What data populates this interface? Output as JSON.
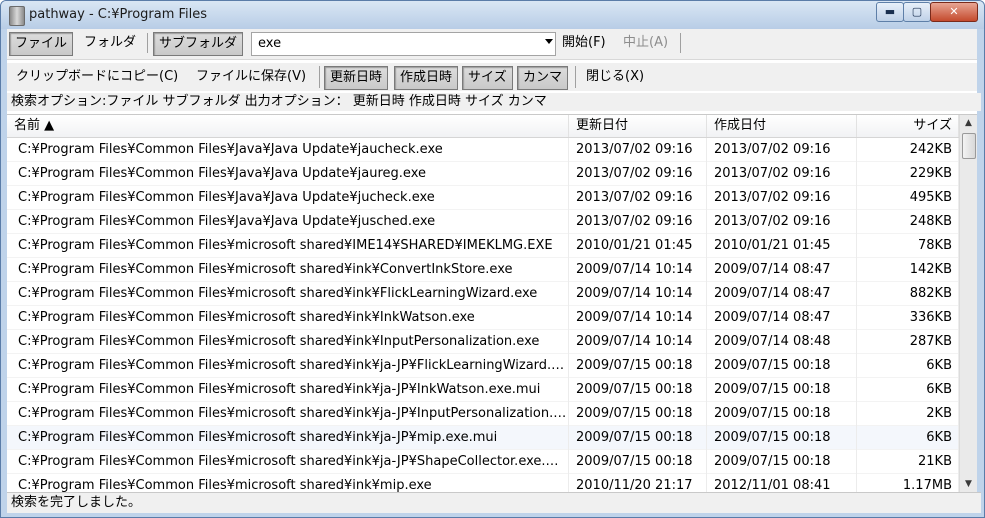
{
  "window": {
    "title": "pathway - C:¥Program Files",
    "min_glyph": "▬",
    "max_glyph": "▢",
    "close_glyph": "✕"
  },
  "toolbar1": {
    "file": "ファイル",
    "folder": "フォルダ",
    "subfolder": "サブフォルダ",
    "search_value": "exe",
    "start": "開始(F)",
    "stop": "中止(A)"
  },
  "toolbar2": {
    "copy": "クリップボードにコピー(C)",
    "save": "ファイルに保存(V)",
    "modified": "更新日時",
    "created": "作成日時",
    "size": "サイズ",
    "comma": "カンマ",
    "close": "閉じる(X)"
  },
  "options_line": "検索オプション:ファイル サブフォルダ 出力オプション： 更新日時 作成日時 サイズ カンマ",
  "columns": {
    "name": "名前 ▲",
    "modified": "更新日付",
    "created": "作成日付",
    "size": "サイズ"
  },
  "rows": [
    {
      "name": "C:¥Program Files¥Common Files¥Java¥Java Update¥jaucheck.exe",
      "modified": "2013/07/02 09:16",
      "created": "2013/07/02 09:16",
      "size": "242KB"
    },
    {
      "name": "C:¥Program Files¥Common Files¥Java¥Java Update¥jaureg.exe",
      "modified": "2013/07/02 09:16",
      "created": "2013/07/02 09:16",
      "size": "229KB"
    },
    {
      "name": "C:¥Program Files¥Common Files¥Java¥Java Update¥jucheck.exe",
      "modified": "2013/07/02 09:16",
      "created": "2013/07/02 09:16",
      "size": "495KB"
    },
    {
      "name": "C:¥Program Files¥Common Files¥Java¥Java Update¥jusched.exe",
      "modified": "2013/07/02 09:16",
      "created": "2013/07/02 09:16",
      "size": "248KB"
    },
    {
      "name": "C:¥Program Files¥Common Files¥microsoft shared¥IME14¥SHARED¥IMEKLMG.EXE",
      "modified": "2010/01/21 01:45",
      "created": "2010/01/21 01:45",
      "size": "78KB"
    },
    {
      "name": "C:¥Program Files¥Common Files¥microsoft shared¥ink¥ConvertInkStore.exe",
      "modified": "2009/07/14 10:14",
      "created": "2009/07/14 08:47",
      "size": "142KB"
    },
    {
      "name": "C:¥Program Files¥Common Files¥microsoft shared¥ink¥FlickLearningWizard.exe",
      "modified": "2009/07/14 10:14",
      "created": "2009/07/14 08:47",
      "size": "882KB"
    },
    {
      "name": "C:¥Program Files¥Common Files¥microsoft shared¥ink¥InkWatson.exe",
      "modified": "2009/07/14 10:14",
      "created": "2009/07/14 08:47",
      "size": "336KB"
    },
    {
      "name": "C:¥Program Files¥Common Files¥microsoft shared¥ink¥InputPersonalization.exe",
      "modified": "2009/07/14 10:14",
      "created": "2009/07/14 08:48",
      "size": "287KB"
    },
    {
      "name": "C:¥Program Files¥Common Files¥microsoft shared¥ink¥ja-JP¥FlickLearningWizard.e...",
      "modified": "2009/07/15 00:18",
      "created": "2009/07/15 00:18",
      "size": "6KB"
    },
    {
      "name": "C:¥Program Files¥Common Files¥microsoft shared¥ink¥ja-JP¥InkWatson.exe.mui",
      "modified": "2009/07/15 00:18",
      "created": "2009/07/15 00:18",
      "size": "6KB"
    },
    {
      "name": "C:¥Program Files¥Common Files¥microsoft shared¥ink¥ja-JP¥InputPersonalization.e...",
      "modified": "2009/07/15 00:18",
      "created": "2009/07/15 00:18",
      "size": "2KB"
    },
    {
      "name": "C:¥Program Files¥Common Files¥microsoft shared¥ink¥ja-JP¥mip.exe.mui",
      "modified": "2009/07/15 00:18",
      "created": "2009/07/15 00:18",
      "size": "6KB"
    },
    {
      "name": "C:¥Program Files¥Common Files¥microsoft shared¥ink¥ja-JP¥ShapeCollector.exe.mui",
      "modified": "2009/07/15 00:18",
      "created": "2009/07/15 00:18",
      "size": "21KB"
    },
    {
      "name": "C:¥Program Files¥Common Files¥microsoft shared¥ink¥mip.exe",
      "modified": "2010/11/20 21:17",
      "created": "2012/11/01 08:41",
      "size": "1.17MB"
    }
  ],
  "selected_row": 12,
  "status": "検索を完了しました。",
  "scroll": {
    "up_glyph": "▲",
    "down_glyph": "▼"
  }
}
